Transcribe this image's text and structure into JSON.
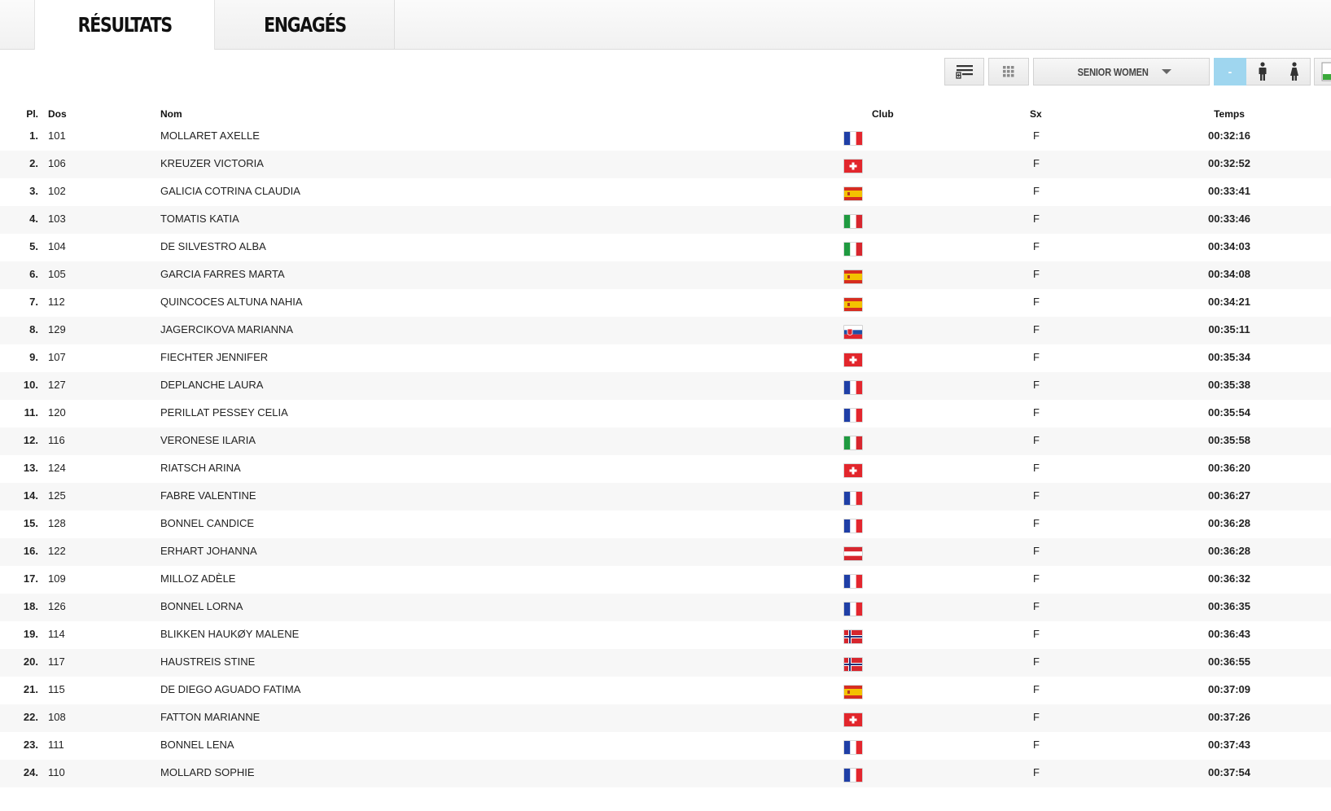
{
  "tabs": [
    {
      "label": "RÉSULTATS",
      "active": true
    },
    {
      "label": "ENGAGÉS",
      "active": false
    }
  ],
  "toolbar": {
    "category": "SENIOR WOMEN",
    "all_label": "-",
    "active_color": "#9fd6ef"
  },
  "columns": {
    "pl": "Pl.",
    "dos": "Dos",
    "nom": "Nom",
    "club": "Club",
    "sx": "Sx",
    "temps": "Temps"
  },
  "rows": [
    {
      "pl": "1.",
      "dos": "101",
      "nom": "MOLLARET AXELLE",
      "flag": "fr",
      "sx": "F",
      "time": "00:32:16"
    },
    {
      "pl": "2.",
      "dos": "106",
      "nom": "KREUZER VICTORIA",
      "flag": "ch",
      "sx": "F",
      "time": "00:32:52"
    },
    {
      "pl": "3.",
      "dos": "102",
      "nom": "GALICIA COTRINA CLAUDIA",
      "flag": "es",
      "sx": "F",
      "time": "00:33:41"
    },
    {
      "pl": "4.",
      "dos": "103",
      "nom": "TOMATIS KATIA",
      "flag": "it",
      "sx": "F",
      "time": "00:33:46"
    },
    {
      "pl": "5.",
      "dos": "104",
      "nom": "DE SILVESTRO ALBA",
      "flag": "it",
      "sx": "F",
      "time": "00:34:03"
    },
    {
      "pl": "6.",
      "dos": "105",
      "nom": "GARCIA FARRES MARTA",
      "flag": "es",
      "sx": "F",
      "time": "00:34:08"
    },
    {
      "pl": "7.",
      "dos": "112",
      "nom": "QUINCOCES ALTUNA NAHIA",
      "flag": "es",
      "sx": "F",
      "time": "00:34:21"
    },
    {
      "pl": "8.",
      "dos": "129",
      "nom": "JAGERCIKOVA MARIANNA",
      "flag": "sk",
      "sx": "F",
      "time": "00:35:11"
    },
    {
      "pl": "9.",
      "dos": "107",
      "nom": "FIECHTER JENNIFER",
      "flag": "ch",
      "sx": "F",
      "time": "00:35:34"
    },
    {
      "pl": "10.",
      "dos": "127",
      "nom": "DEPLANCHE LAURA",
      "flag": "fr",
      "sx": "F",
      "time": "00:35:38"
    },
    {
      "pl": "11.",
      "dos": "120",
      "nom": "PERILLAT PESSEY CELIA",
      "flag": "fr",
      "sx": "F",
      "time": "00:35:54"
    },
    {
      "pl": "12.",
      "dos": "116",
      "nom": "VERONESE ILARIA",
      "flag": "it",
      "sx": "F",
      "time": "00:35:58"
    },
    {
      "pl": "13.",
      "dos": "124",
      "nom": "RIATSCH ARINA",
      "flag": "ch",
      "sx": "F",
      "time": "00:36:20"
    },
    {
      "pl": "14.",
      "dos": "125",
      "nom": "FABRE VALENTINE",
      "flag": "fr",
      "sx": "F",
      "time": "00:36:27"
    },
    {
      "pl": "15.",
      "dos": "128",
      "nom": "BONNEL CANDICE",
      "flag": "fr",
      "sx": "F",
      "time": "00:36:28"
    },
    {
      "pl": "16.",
      "dos": "122",
      "nom": "ERHART JOHANNA",
      "flag": "at",
      "sx": "F",
      "time": "00:36:28"
    },
    {
      "pl": "17.",
      "dos": "109",
      "nom": "MILLOZ ADÈLE",
      "flag": "fr",
      "sx": "F",
      "time": "00:36:32"
    },
    {
      "pl": "18.",
      "dos": "126",
      "nom": "BONNEL LORNA",
      "flag": "fr",
      "sx": "F",
      "time": "00:36:35"
    },
    {
      "pl": "19.",
      "dos": "114",
      "nom": "BLIKKEN HAUKØY MALENE",
      "flag": "no",
      "sx": "F",
      "time": "00:36:43"
    },
    {
      "pl": "20.",
      "dos": "117",
      "nom": "HAUSTREIS STINE",
      "flag": "no",
      "sx": "F",
      "time": "00:36:55"
    },
    {
      "pl": "21.",
      "dos": "115",
      "nom": "DE DIEGO AGUADO FATIMA",
      "flag": "es",
      "sx": "F",
      "time": "00:37:09"
    },
    {
      "pl": "22.",
      "dos": "108",
      "nom": "FATTON MARIANNE",
      "flag": "ch",
      "sx": "F",
      "time": "00:37:26"
    },
    {
      "pl": "23.",
      "dos": "111",
      "nom": "BONNEL LENA",
      "flag": "fr",
      "sx": "F",
      "time": "00:37:43"
    },
    {
      "pl": "24.",
      "dos": "110",
      "nom": "MOLLARD SOPHIE",
      "flag": "fr",
      "sx": "F",
      "time": "00:37:54"
    }
  ]
}
